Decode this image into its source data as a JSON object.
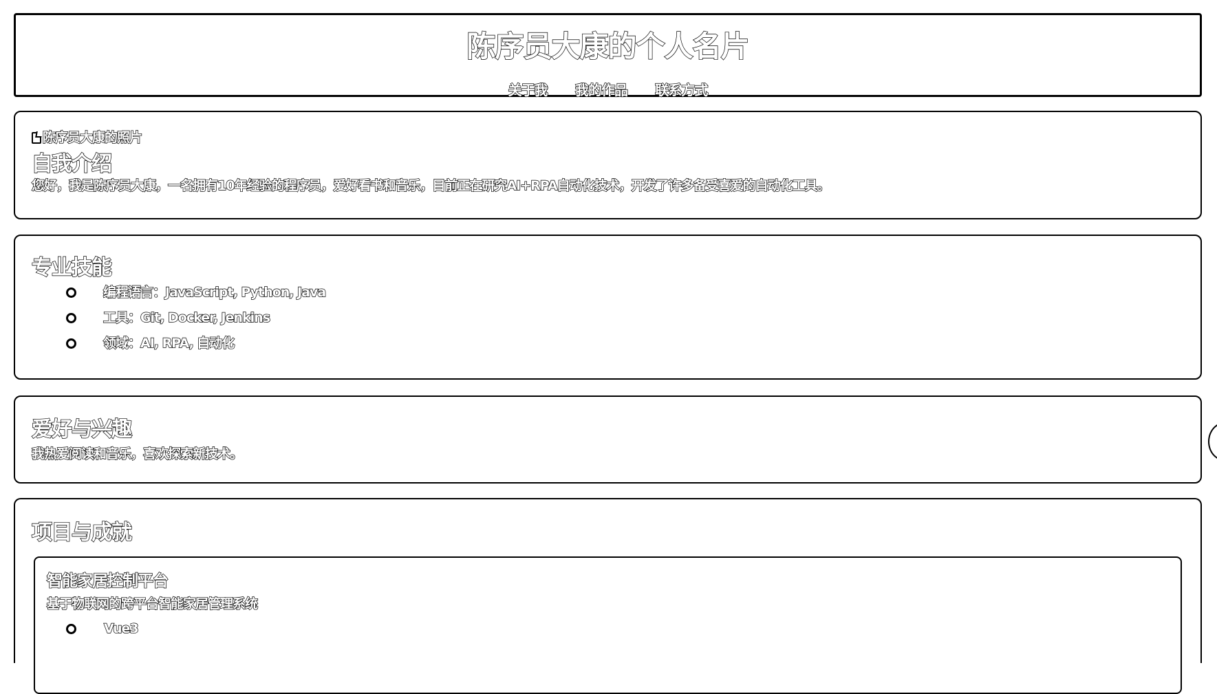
{
  "header": {
    "title": "陈序员大康的个人名片",
    "nav": [
      "关于我",
      "我的作品",
      "联系方式"
    ]
  },
  "about": {
    "photo_alt": "陈序员大康的照片",
    "heading": "自我介绍",
    "text": "您好，我是陈序员大康，一名拥有10年经验的程序员，爱好看书和音乐，目前正在研究AI+RPA自动化技术，开发了许多备受喜爱的自动化工具。"
  },
  "skills": {
    "heading": "专业技能",
    "items": [
      "编程语言：JavaScript, Python, Java",
      "工具：Git, Docker, Jenkins",
      "领域：AI, RPA, 自动化"
    ]
  },
  "hobbies": {
    "heading": "爱好与兴趣",
    "text": "我热爱阅读和音乐，喜欢探索新技术。"
  },
  "projects": {
    "heading": "项目与成就",
    "items": [
      {
        "title": "智能家居控制平台",
        "description": "基于物联网的跨平台智能家居管理系统",
        "tech": [
          "Vue3"
        ]
      }
    ]
  }
}
